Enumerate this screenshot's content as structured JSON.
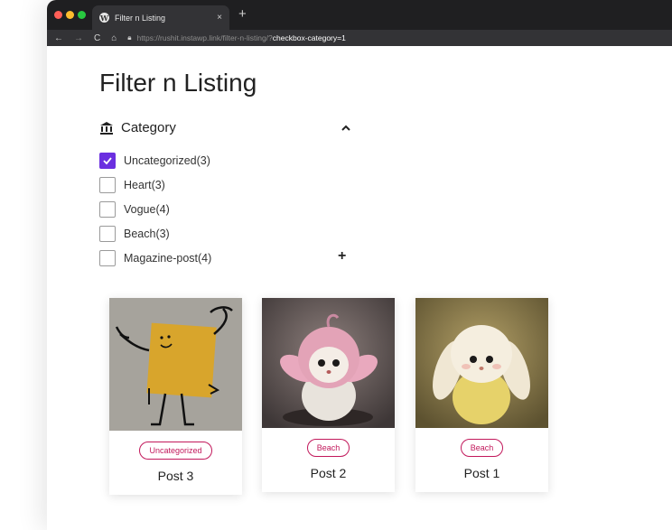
{
  "browser": {
    "tab_title": "Filter n Listing",
    "tab_close": "×",
    "new_tab": "+",
    "url_host": "https://rushit.instawp.link/filter-n-listing/?",
    "url_query": "checkbox-category=1"
  },
  "page": {
    "title": "Filter n Listing"
  },
  "filter": {
    "title": "Category",
    "options": [
      {
        "label": "Uncategorized(3)",
        "checked": true
      },
      {
        "label": "Heart(3)",
        "checked": false
      },
      {
        "label": "Vogue(4)",
        "checked": false
      },
      {
        "label": "Beach(3)",
        "checked": false
      },
      {
        "label": "Magazine-post(4)",
        "checked": false
      }
    ],
    "accent": "#6b2fe0"
  },
  "posts": [
    {
      "badge": "Uncategorized",
      "title": "Post 3"
    },
    {
      "badge": "Beach",
      "title": "Post 2"
    },
    {
      "badge": "Beach",
      "title": "Post 1"
    }
  ],
  "colors": {
    "badge": "#c2185b"
  }
}
